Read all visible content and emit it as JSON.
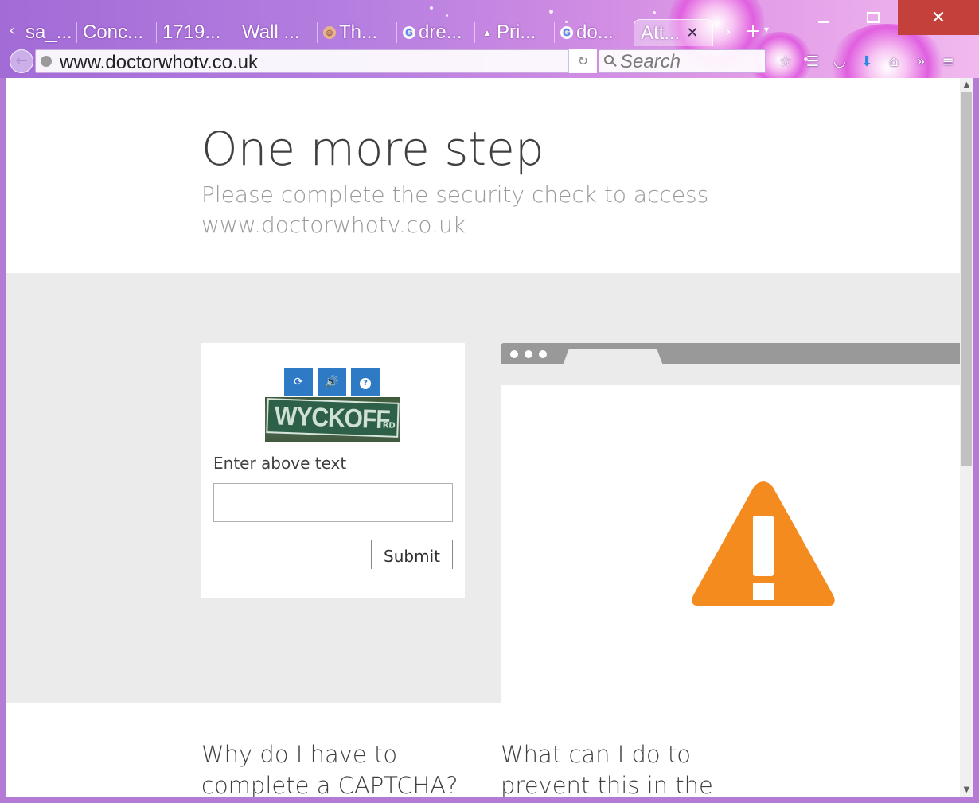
{
  "browser": {
    "tabs": [
      {
        "label": "sa_...",
        "favicon": "none"
      },
      {
        "label": "Conc...",
        "favicon": "none"
      },
      {
        "label": "1719...",
        "favicon": "none"
      },
      {
        "label": "Wall ...",
        "favicon": "none"
      },
      {
        "label": "Th...",
        "favicon": "face-icon"
      },
      {
        "label": "dre...",
        "favicon": "google-icon"
      },
      {
        "label": "Pri...",
        "favicon": "party-hat-icon"
      },
      {
        "label": "do...",
        "favicon": "google-icon"
      },
      {
        "label": "Att...",
        "favicon": "none",
        "active": true
      }
    ],
    "url": "www.doctorwhotv.co.uk",
    "search_placeholder": "Search"
  },
  "page": {
    "title": "One more step",
    "subtitle": "Please complete the security check to access www.doctorwhotv.co.uk",
    "captcha": {
      "image_text": "WYCKOFF",
      "image_subtext": "RD",
      "label": "Enter above text",
      "input_value": "",
      "submit_label": "Submit"
    },
    "warning_color": "#f38b1f",
    "faq": {
      "q1": "Why do I have to complete a CAPTCHA?",
      "q2": "What can I do to prevent this in the"
    }
  },
  "colors": {
    "captcha_button": "#2f7ac4",
    "close_button": "#c4403a"
  }
}
